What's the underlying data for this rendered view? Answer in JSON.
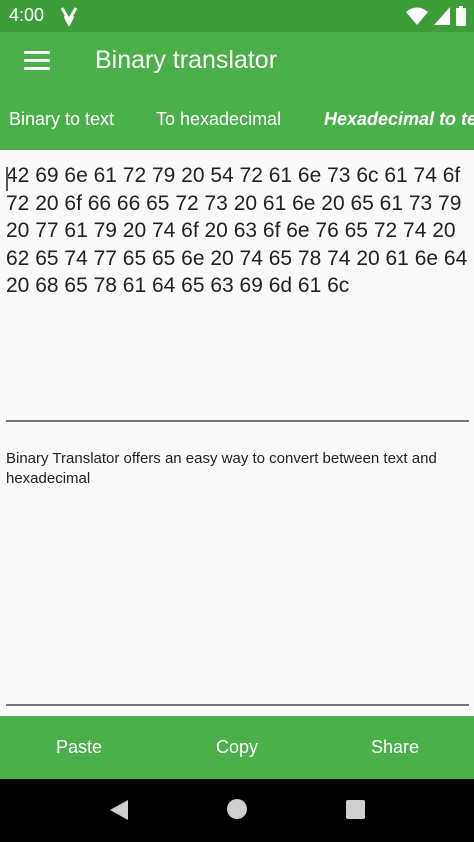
{
  "status_bar": {
    "time": "4:00",
    "notification_icon": "notification-icon",
    "wifi_icon": "wifi-icon",
    "signal_icon": "signal-icon",
    "battery_icon": "battery-icon"
  },
  "app_bar": {
    "menu_icon": "menu-icon",
    "title": "Binary translator"
  },
  "tabs": [
    {
      "label": "Binary to text",
      "active": false
    },
    {
      "label": "To hexadecimal",
      "active": false
    },
    {
      "label": "Hexadecimal to text",
      "active": true
    }
  ],
  "input": {
    "value": "42 69 6e 61 72 79 20 54 72 61 6e 73 6c 61 74 6f 72 20 6f 66 66 65 72 73 20 61 6e 20 65 61 73 79 20 77 61 79 20 74 6f 20 63 6f 6e 76 65 72 74 20 62 65 74 77 65 65 6e 20 74 65 78 74 20 61 6e 64 20 68 65 78 61 64 65 63 69 6d 61 6c"
  },
  "output": {
    "text": "Binary Translator offers an easy way to convert between text and hexadecimal"
  },
  "actions": {
    "paste_label": "Paste",
    "copy_label": "Copy",
    "share_label": "Share"
  },
  "nav": {
    "back_icon": "back-icon",
    "home_icon": "home-icon",
    "recents_icon": "recents-icon"
  },
  "colors": {
    "status_bar": "#3d9e39",
    "primary": "#4cb04a",
    "background": "#fafafa",
    "nav_bar": "#000000"
  }
}
